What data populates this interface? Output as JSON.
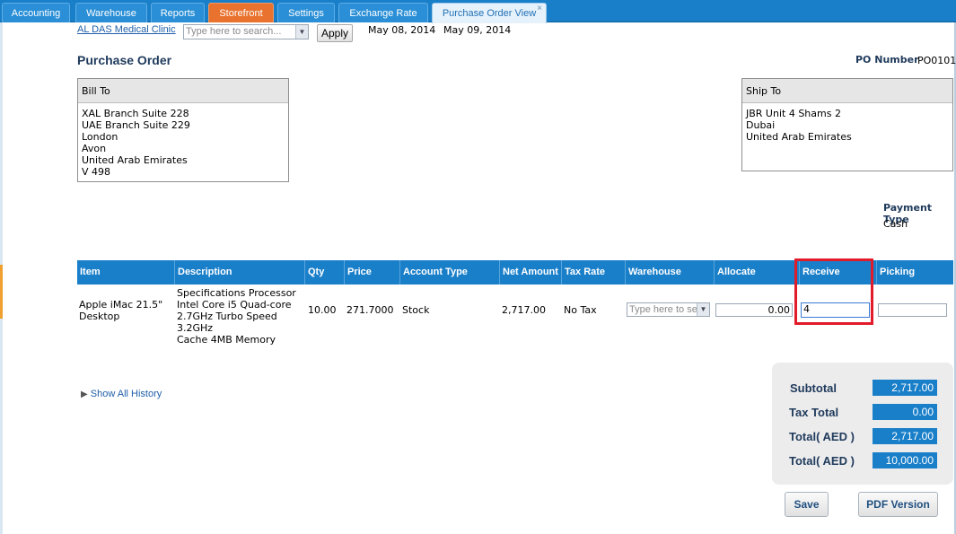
{
  "tabs": [
    {
      "label": "Accounting"
    },
    {
      "label": "Warehouse"
    },
    {
      "label": "Reports"
    },
    {
      "label": "Storefront"
    },
    {
      "label": "Settings"
    },
    {
      "label": "Exchange Rate"
    },
    {
      "label": "Purchase Order View",
      "close": "×"
    }
  ],
  "header": {
    "vendor_link": "AL DAS Medical Clinic",
    "search_placeholder": "Type here to search...",
    "apply_label": "Apply",
    "date1": "May 08, 2014",
    "date2": "May 09, 2014"
  },
  "page_title": "Purchase Order",
  "po": {
    "label": "PO Number",
    "value": "PO0101"
  },
  "bill_to": {
    "heading": "Bill To",
    "lines": [
      "XAL Branch Suite 228",
      "UAE Branch Suite 229",
      "London",
      "Avon",
      "United Arab Emirates",
      "V 498"
    ]
  },
  "ship_to": {
    "heading": "Ship To",
    "lines": [
      "JBR Unit 4 Shams 2",
      "Dubai",
      "United Arab Emirates"
    ]
  },
  "payment": {
    "label": "Payment Type",
    "value": "Cash"
  },
  "table": {
    "columns": [
      "Item",
      "Description",
      "Qty",
      "Price",
      "Account Type",
      "Net Amount",
      "Tax Rate",
      "Warehouse",
      "Allocate",
      "Receive",
      "Picking"
    ],
    "row": {
      "item_line1": "Apple iMac 21.5\"",
      "item_line2": "Desktop",
      "desc_lines": [
        "Specifications Processor",
        "Intel Core i5 Quad-core",
        "2.7GHz Turbo Speed 3.2GHz",
        "Cache 4MB Memory"
      ],
      "qty": "10.00",
      "price": "271.7000",
      "account_type": "Stock",
      "net_amount": "2,717.00",
      "tax_rate": "No Tax",
      "warehouse_placeholder": "Type here to search...",
      "allocate": "0.00",
      "receive": "4",
      "picking": ""
    }
  },
  "history_link": "Show All History",
  "totals": [
    {
      "label": "Subtotal",
      "value": "2,717.00"
    },
    {
      "label": "Tax Total",
      "value": "0.00"
    },
    {
      "label": "Total( AED )",
      "value": "2,717.00"
    },
    {
      "label": "Total( AED )",
      "value": "10,000.00"
    }
  ],
  "buttons": {
    "save": "Save",
    "pdf": "PDF Version"
  },
  "colors": {
    "tab_blue": "#1a7fc9",
    "tab_orange": "#e8722e",
    "highlight_red": "#e21b2b"
  }
}
